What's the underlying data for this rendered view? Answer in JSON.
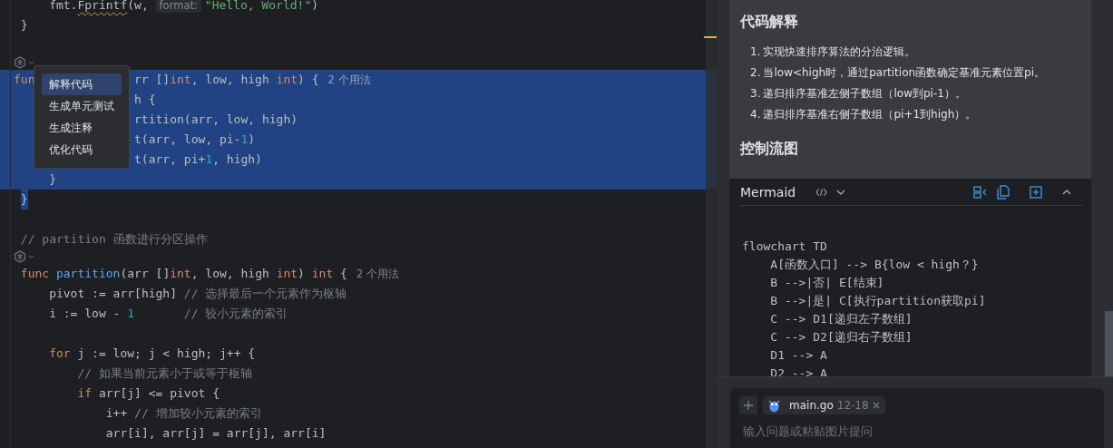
{
  "editor": {
    "lines": [
      {
        "kind": "code",
        "selected": false,
        "tokens": [
          {
            "kind": "plain",
            "text": "    fmt."
          },
          {
            "kind": "warned",
            "text": "Fprintf"
          },
          {
            "kind": "plain",
            "text": "(w, "
          },
          {
            "kind": "inlay",
            "text": "format:"
          },
          {
            "kind": "str",
            "text": "\"Hello, World!\""
          },
          {
            "kind": "plain",
            "text": ")"
          }
        ]
      },
      {
        "kind": "code",
        "selected": false,
        "tokens": [
          {
            "kind": "plain",
            "text": "}"
          }
        ]
      },
      {
        "kind": "blank"
      },
      {
        "kind": "lens"
      },
      {
        "kind": "covered",
        "selected": true,
        "before": [
          {
            "kind": "kw",
            "text": "fun"
          }
        ],
        "tokens": [
          {
            "kind": "plain",
            "text": "rr []"
          },
          {
            "kind": "type",
            "text": "int"
          },
          {
            "kind": "plain",
            "text": ", low, high "
          },
          {
            "kind": "type",
            "text": "int"
          },
          {
            "kind": "plain",
            "text": ") {"
          },
          {
            "kind": "usage",
            "text": "2 个用法"
          }
        ]
      },
      {
        "kind": "covered",
        "selected": true,
        "tokens": [
          {
            "kind": "plain",
            "text": "h {"
          }
        ]
      },
      {
        "kind": "covered",
        "selected": true,
        "tokens": [
          {
            "kind": "plain",
            "text": "rtition(arr, low, high)"
          }
        ]
      },
      {
        "kind": "covered",
        "selected": true,
        "tokens": [
          {
            "kind": "plain",
            "text": "t(arr, low, pi-"
          },
          {
            "kind": "num",
            "text": "1"
          },
          {
            "kind": "plain",
            "text": ")"
          }
        ]
      },
      {
        "kind": "covered",
        "selected": true,
        "tokens": [
          {
            "kind": "plain",
            "text": "t(arr, pi+"
          },
          {
            "kind": "num",
            "text": "1"
          },
          {
            "kind": "plain",
            "text": ", high)"
          }
        ]
      },
      {
        "kind": "code",
        "selected": true,
        "tokens": [
          {
            "kind": "plain",
            "text": "    }"
          }
        ]
      },
      {
        "kind": "code",
        "selected": true,
        "tokens": [
          {
            "kind": "plain",
            "text": "}"
          }
        ]
      },
      {
        "kind": "blank"
      },
      {
        "kind": "code",
        "selected": false,
        "tokens": [
          {
            "kind": "cmt",
            "text": "// partition 函数进行分区操作"
          }
        ]
      },
      {
        "kind": "lens"
      },
      {
        "kind": "code",
        "selected": false,
        "tokens": [
          {
            "kind": "kw",
            "text": "func "
          },
          {
            "kind": "fn",
            "text": "partition"
          },
          {
            "kind": "plain",
            "text": "(arr []"
          },
          {
            "kind": "type",
            "text": "int"
          },
          {
            "kind": "plain",
            "text": ", low, high "
          },
          {
            "kind": "type",
            "text": "int"
          },
          {
            "kind": "plain",
            "text": ") "
          },
          {
            "kind": "type",
            "text": "int"
          },
          {
            "kind": "plain",
            "text": " {"
          },
          {
            "kind": "usage",
            "text": "2 个用法"
          }
        ]
      },
      {
        "kind": "code",
        "selected": false,
        "tokens": [
          {
            "kind": "plain",
            "text": "    pivot := arr[high] "
          },
          {
            "kind": "cmt",
            "text": "// 选择最后一个元素作为枢轴"
          }
        ]
      },
      {
        "kind": "code",
        "selected": false,
        "tokens": [
          {
            "kind": "plain",
            "text": "    i := low - "
          },
          {
            "kind": "num",
            "text": "1"
          },
          {
            "kind": "cmt",
            "text": "       // 较小元素的索引"
          }
        ]
      },
      {
        "kind": "blank"
      },
      {
        "kind": "code",
        "selected": false,
        "tokens": [
          {
            "kind": "kw",
            "text": "    for"
          },
          {
            "kind": "plain",
            "text": " j := low; j < high; j++ {"
          }
        ]
      },
      {
        "kind": "code",
        "selected": false,
        "tokens": [
          {
            "kind": "cmt",
            "text": "        // 如果当前元素小于或等于枢轴"
          }
        ]
      },
      {
        "kind": "code",
        "selected": false,
        "tokens": [
          {
            "kind": "kw",
            "text": "        if"
          },
          {
            "kind": "plain",
            "text": " arr[j] <= pivot {"
          }
        ]
      },
      {
        "kind": "code",
        "selected": false,
        "tokens": [
          {
            "kind": "plain",
            "text": "            i++ "
          },
          {
            "kind": "cmt",
            "text": "// 增加较小元素的索引"
          }
        ]
      },
      {
        "kind": "code",
        "selected": false,
        "tokens": [
          {
            "kind": "plain",
            "text": "            arr[i], arr[j] = arr[j], arr[i]"
          }
        ]
      }
    ]
  },
  "popup_menu": {
    "items": [
      {
        "label": "解释代码",
        "selected": true
      },
      {
        "label": "生成单元测试",
        "selected": false
      },
      {
        "label": "生成注释",
        "selected": false
      },
      {
        "label": "优化代码",
        "selected": false
      }
    ]
  },
  "explanation": {
    "title": "代码解释",
    "items": [
      {
        "number": "1.",
        "text": "实现快速排序算法的分治逻辑。"
      },
      {
        "number": "2.",
        "text": "当low<high时，通过partition函数确定基准元素位置pi。"
      },
      {
        "number": "3.",
        "text": "递归排序基准左侧子数组（low到pi-1）。"
      },
      {
        "number": "4.",
        "text": "递归排序基准右侧子数组（pi+1到high）。"
      }
    ]
  },
  "flow": {
    "title": "控制流图",
    "language": "Mermaid",
    "lines": [
      "flowchart TD",
      "    A[函数入口] --> B{low < high？}",
      "    B -->|否| E[结束]",
      "    B -->|是| C[执行partition获取pi]",
      "    C --> D1[递归左子数组]",
      "    C --> D2[递归右子数组]",
      "    D1 --> A",
      "    D2 --> A"
    ]
  },
  "chat_input": {
    "file_chip": {
      "name": "main.go",
      "range": "12-18"
    },
    "placeholder": "输入问题或粘贴图片提问"
  }
}
